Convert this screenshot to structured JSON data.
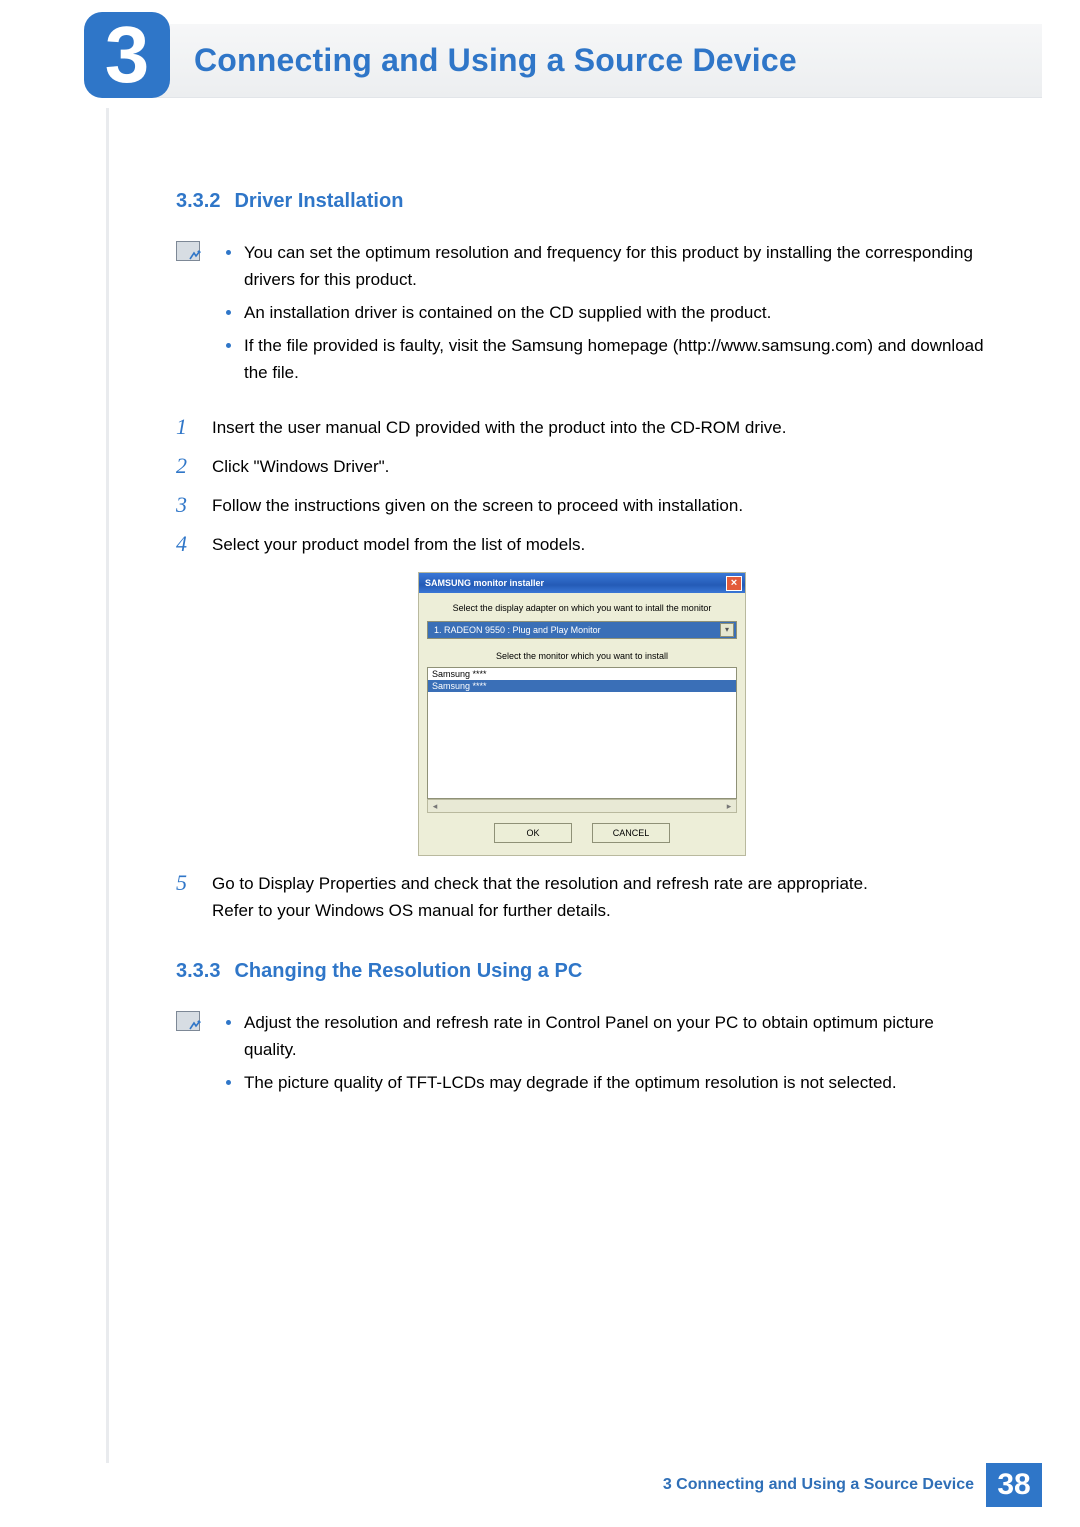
{
  "chapter": {
    "number": "3",
    "title": "Connecting and Using a Source Device"
  },
  "sec_332": {
    "num": "3.3.2",
    "title": "Driver Installation",
    "notes": [
      "You can set the optimum resolution and frequency for this product by installing the corresponding drivers for this product.",
      "An installation driver is contained on the CD supplied with the product.",
      "If the file provided is faulty, visit the Samsung homepage (http://www.samsung.com) and download the file."
    ],
    "steps": {
      "s1": "Insert the user manual CD provided with the product into the CD-ROM drive.",
      "s2": "Click \"Windows Driver\".",
      "s3": "Follow the instructions given on the screen to proceed with installation.",
      "s4": "Select your product model from the list of models.",
      "s5a": "Go to Display Properties and check that the resolution and refresh rate are appropriate.",
      "s5b": "Refer to your Windows OS manual for further details."
    }
  },
  "installer": {
    "title": "SAMSUNG monitor installer",
    "line1": "Select the display adapter on which you want to intall the monitor",
    "adapter": "1. RADEON 9550 : Plug and Play Monitor",
    "line2": "Select the monitor which you want to install",
    "list0": "Samsung ****",
    "list1": "Samsung ****",
    "ok": "OK",
    "cancel": "CANCEL"
  },
  "sec_333": {
    "num": "3.3.3",
    "title": "Changing the Resolution Using a PC",
    "notes": [
      "Adjust the resolution and refresh rate in Control Panel on your PC to obtain optimum picture quality.",
      "The picture quality of TFT-LCDs may degrade if the optimum resolution is not selected."
    ]
  },
  "footer": {
    "text": "3 Connecting and Using a Source Device",
    "page": "38"
  }
}
